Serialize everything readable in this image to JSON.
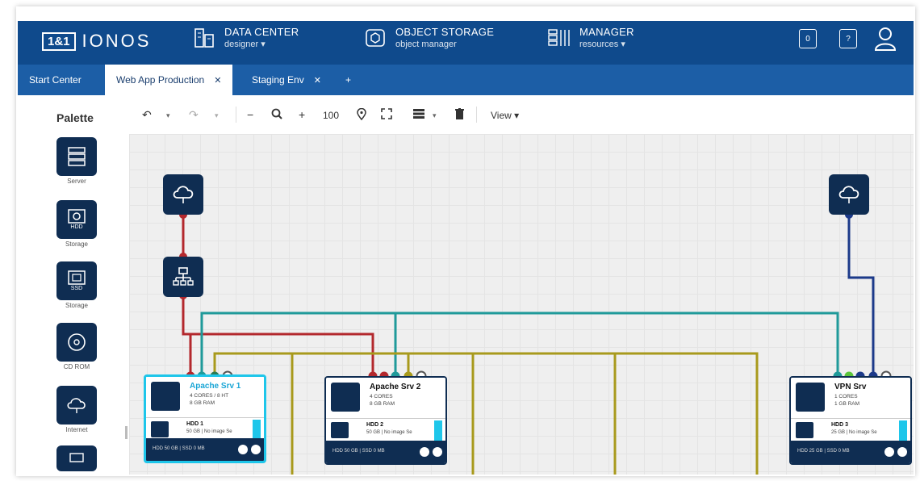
{
  "header": {
    "logo_box": "1&1",
    "logo_text": "IONOS",
    "nav": [
      {
        "title": "DATA CENTER",
        "sub": "designer ▾",
        "icon": "data-center-icon"
      },
      {
        "title": "OBJECT STORAGE",
        "sub": "object manager",
        "icon": "object-storage-icon"
      },
      {
        "title": "MANAGER",
        "sub": "resources ▾",
        "icon": "manager-icon"
      }
    ],
    "badge_count": "0",
    "help_label": "?"
  },
  "tabs": [
    {
      "label": "Start Center",
      "close": ""
    },
    {
      "label": "Web App Production",
      "close": "✕"
    },
    {
      "label": "Staging Env",
      "close": "✕"
    },
    {
      "label": "+",
      "close": ""
    }
  ],
  "palette": {
    "title": "Palette",
    "items": [
      {
        "label": "Server",
        "tile_text": ""
      },
      {
        "label": "Storage",
        "tile_text": "HDD"
      },
      {
        "label": "Storage",
        "tile_text": "SSD"
      },
      {
        "label": "CD ROM",
        "tile_text": ""
      },
      {
        "label": "Internet",
        "tile_text": ""
      }
    ]
  },
  "toolbar": {
    "zoom": "100",
    "view_label": "View ▾"
  },
  "servers": [
    {
      "name": "Apache Srv 1",
      "spec1": "4 CORES / 8 HT",
      "spec2": "8 GB RAM",
      "hdd_name": "HDD 1",
      "hdd_spec": "50 GB | No image Se",
      "footer": "HDD 50 GB | SSD 0 MB"
    },
    {
      "name": "Apache Srv 2",
      "spec1": "4 CORES",
      "spec2": "8 GB RAM",
      "hdd_name": "HDD 2",
      "hdd_spec": "50 GB | No image Se",
      "footer": "HDD 50 GB | SSD 0 MB"
    },
    {
      "name": "VPN Srv",
      "spec1": "1 CORES",
      "spec2": "1 GB RAM",
      "hdd_name": "HDD 3",
      "hdd_spec": "25 GB | No image Se",
      "footer": "HDD 25 GB | SSD 0 MB"
    }
  ],
  "colors": {
    "header": "#0f4a8c",
    "tabbar": "#1c5ea6",
    "node": "#0f2d52",
    "selected": "#1ec6ea",
    "wire_red": "#b3282d",
    "wire_teal": "#1f9a9a",
    "wire_olive": "#a89a1c",
    "wire_blue": "#1c3a8a"
  }
}
